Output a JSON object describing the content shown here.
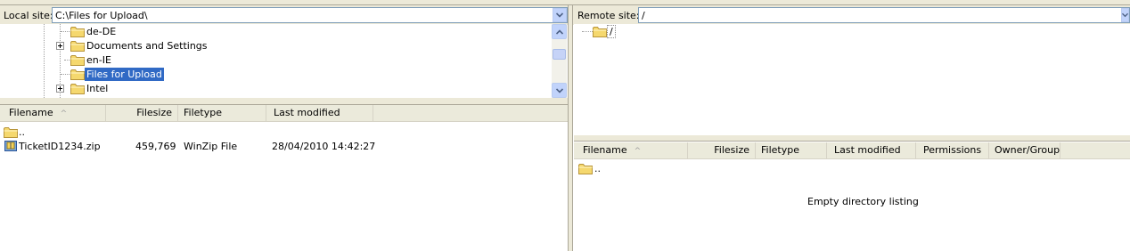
{
  "local": {
    "site_label": "Local site:",
    "path": "C:\\Files for Upload\\",
    "tree": [
      {
        "label": "de-DE",
        "expandable": false,
        "selected": false
      },
      {
        "label": "Documents and Settings",
        "expandable": true,
        "selected": false
      },
      {
        "label": "en-IE",
        "expandable": false,
        "selected": false
      },
      {
        "label": "Files for Upload",
        "expandable": false,
        "selected": true
      },
      {
        "label": "Intel",
        "expandable": true,
        "selected": false
      }
    ],
    "columns": [
      "Filename",
      "Filesize",
      "Filetype",
      "Last modified"
    ],
    "sort_indicator": "^",
    "files": [
      {
        "name": "..",
        "size": "",
        "type": "",
        "modified": "",
        "icon": "folder-icon"
      },
      {
        "name": "TicketID1234.zip",
        "size": "459,769",
        "type": "WinZip File",
        "modified": "28/04/2010 14:42:27",
        "icon": "zip-file-icon"
      }
    ]
  },
  "remote": {
    "site_label": "Remote site:",
    "path": "/",
    "tree": [
      {
        "label": "/",
        "expandable": false,
        "selected": false
      }
    ],
    "columns": [
      "Filename",
      "Filesize",
      "Filetype",
      "Last modified",
      "Permissions",
      "Owner/Group"
    ],
    "sort_indicator": "^",
    "files": [
      {
        "name": "..",
        "icon": "folder-icon"
      }
    ],
    "empty_message": "Empty directory listing"
  },
  "colors": {
    "chrome": "#ece9d8",
    "selection": "#316ac5",
    "combo_button": "#c1d3fb",
    "folder": "#f5d86e"
  }
}
